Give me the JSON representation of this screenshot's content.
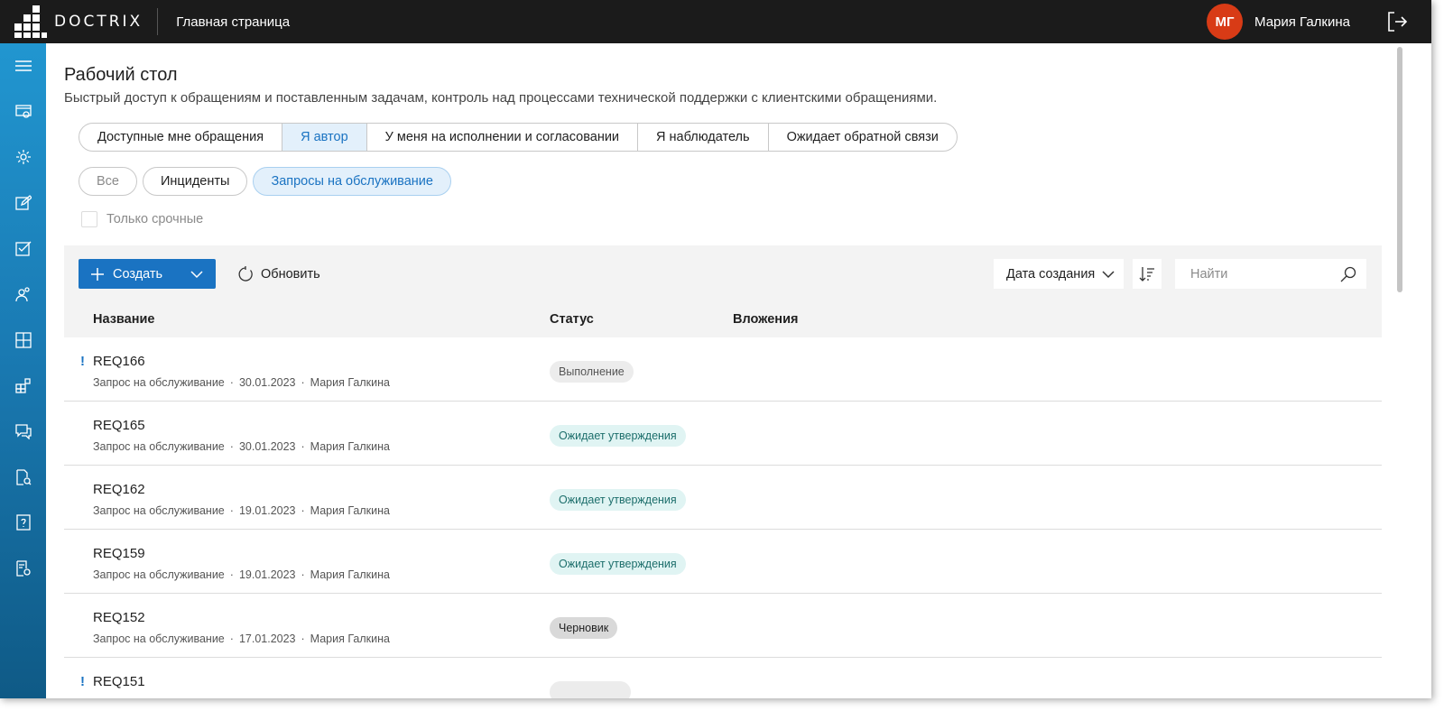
{
  "app": {
    "brand": "DOCTRIX",
    "page_name": "Главная страница"
  },
  "user": {
    "initials": "МГ",
    "name": "Мария Галкина",
    "avatar_color": "#d83b16"
  },
  "colors": {
    "accent": "#1a73c2",
    "topbar": "#1b1b1b",
    "sidebar_top": "#2196d0",
    "sidebar_bottom": "#0f5a86"
  },
  "sidebar": {
    "items": [
      {
        "icon": "menu-icon"
      },
      {
        "icon": "monitor-settings-icon"
      },
      {
        "icon": "gear-icon"
      },
      {
        "icon": "edit-icon"
      },
      {
        "icon": "checkbox-icon"
      },
      {
        "icon": "users-icon"
      },
      {
        "icon": "dashboard-icon"
      },
      {
        "icon": "apps-icon"
      },
      {
        "icon": "chat-icon"
      },
      {
        "icon": "document-search-icon"
      },
      {
        "icon": "help-icon"
      },
      {
        "icon": "report-icon"
      }
    ]
  },
  "header": {
    "title": "Рабочий стол",
    "subtitle": "Быстрый доступ к обращениям и поставленным задачам, контроль над процессами технической поддержки с клиентскими обращениями."
  },
  "tabs": [
    {
      "label": "Доступные мне обращения",
      "active": false
    },
    {
      "label": "Я автор",
      "active": true
    },
    {
      "label": "У меня на исполнении и согласовании",
      "active": false
    },
    {
      "label": "Я наблюдатель",
      "active": false
    },
    {
      "label": "Ожидает обратной связи",
      "active": false
    }
  ],
  "filters": [
    {
      "label": "Все",
      "state": "disabled"
    },
    {
      "label": "Инциденты",
      "state": "normal"
    },
    {
      "label": "Запросы на обслуживание",
      "state": "active"
    }
  ],
  "urgent_only": {
    "label": "Только срочные",
    "checked": false
  },
  "toolbar": {
    "create_label": "Создать",
    "refresh_label": "Обновить",
    "sort_label": "Дата создания",
    "search_placeholder": "Найти"
  },
  "columns": {
    "name": "Название",
    "status": "Статус",
    "attachments": "Вложения"
  },
  "rows": [
    {
      "urgent": "!",
      "id": "REQ166",
      "type": "Запрос на обслуживание",
      "date": "30.01.2023",
      "author": "Мария Галкина",
      "status": "Выполнение",
      "status_kind": "exec"
    },
    {
      "urgent": "",
      "id": "REQ165",
      "type": "Запрос на обслуживание",
      "date": "30.01.2023",
      "author": "Мария Галкина",
      "status": "Ожидает утверждения",
      "status_kind": "wait"
    },
    {
      "urgent": "",
      "id": "REQ162",
      "type": "Запрос на обслуживание",
      "date": "19.01.2023",
      "author": "Мария Галкина",
      "status": "Ожидает утверждения",
      "status_kind": "wait"
    },
    {
      "urgent": "",
      "id": "REQ159",
      "type": "Запрос на обслуживание",
      "date": "19.01.2023",
      "author": "Мария Галкина",
      "status": "Ожидает утверждения",
      "status_kind": "wait"
    },
    {
      "urgent": "",
      "id": "REQ152",
      "type": "Запрос на обслуживание",
      "date": "17.01.2023",
      "author": "Мария Галкина",
      "status": "Черновик",
      "status_kind": "draft"
    },
    {
      "urgent": "!",
      "id": "REQ151",
      "type": "",
      "date": "",
      "author": "",
      "status": "",
      "status_kind": "exec"
    }
  ]
}
